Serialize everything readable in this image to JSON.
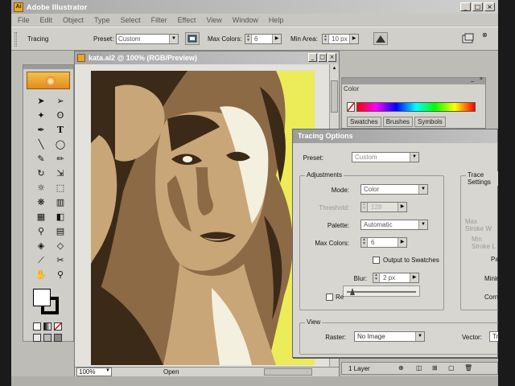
{
  "app": {
    "title": "Adobe Illustrator",
    "icon_letter": "Ai"
  },
  "window_controls": {
    "minimize": "_",
    "maximize": "□",
    "close": "×"
  },
  "menu": [
    "File",
    "Edit",
    "Object",
    "Type",
    "Select",
    "Filter",
    "Effect",
    "View",
    "Window",
    "Help"
  ],
  "control_bar": {
    "tracing_label": "Tracing",
    "preset_label": "Preset:",
    "preset_value": "Custom",
    "max_colors_label": "Max Colors:",
    "max_colors_value": "6",
    "min_area_label": "Min Area:",
    "min_area_value": "10 px"
  },
  "document": {
    "title": "kata.ai2 @ 100% (RGB/Preview)",
    "zoom": "100%",
    "status": "Open"
  },
  "color_panel": {
    "tab": "Color",
    "tabs": [
      "Swatches",
      "Brushes",
      "Symbols"
    ]
  },
  "tracing_dialog": {
    "title": "Tracing Options",
    "preset_label": "Preset:",
    "preset_value": "Custom",
    "adjustments_label": "Adjustments",
    "mode_label": "Mode:",
    "mode_value": "Color",
    "threshold_label": "Threshold:",
    "threshold_value": "128",
    "palette_label": "Palette:",
    "palette_value": "Automatic",
    "max_colors_label": "Max Colors:",
    "max_colors_value": "6",
    "output_swatches_label": "Output to Swatches",
    "blur_label": "Blur:",
    "blur_value": "2 px",
    "resample_label": "Re",
    "trace_settings_label": "Trace Settings",
    "max_stroke_label": "Max Stroke W",
    "min_stroke_label": "Min Stroke L",
    "path_label": "Path",
    "minimum_label": "Minimum",
    "corner_label": "Corne",
    "view_label": "View",
    "raster_label": "Raster:",
    "raster_value": "No Image",
    "vector_label": "Vector:",
    "vector_value": "Tr"
  },
  "layers": {
    "count": "1 Layer"
  },
  "colors": {
    "canvas_bg": "#eeee55",
    "hair_dark": "#3b2a18",
    "skin_mid": "#8c6a45",
    "skin_light": "#c9a678",
    "highlight": "#f4f0e0"
  }
}
